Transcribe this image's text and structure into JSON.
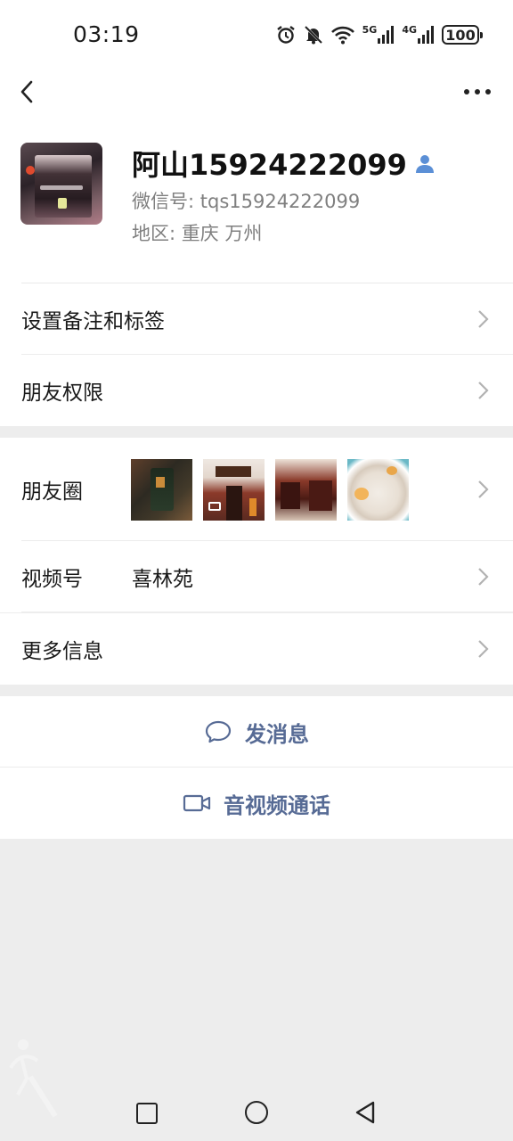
{
  "status_bar": {
    "time": "03:19",
    "icons": [
      "alarm-icon",
      "mute-bell-icon",
      "wifi-icon",
      "5g-signal-icon",
      "4g-signal-icon",
      "battery-icon"
    ],
    "net1": "5G",
    "net2": "4G",
    "battery": "100"
  },
  "profile": {
    "name": "阿山15924222099",
    "wechat_id": "微信号:  tqs15924222099",
    "region": "地区:  重庆  万州"
  },
  "menu": {
    "remark": "设置备注和标签",
    "permissions": "朋友权限",
    "moments": "朋友圈",
    "channels": "视频号",
    "channels_value": "喜林苑",
    "more_info": "更多信息"
  },
  "actions": {
    "message": "发消息",
    "call": "音视频通话"
  },
  "colors": {
    "link_blue": "#576b95",
    "background": "#ededed"
  }
}
